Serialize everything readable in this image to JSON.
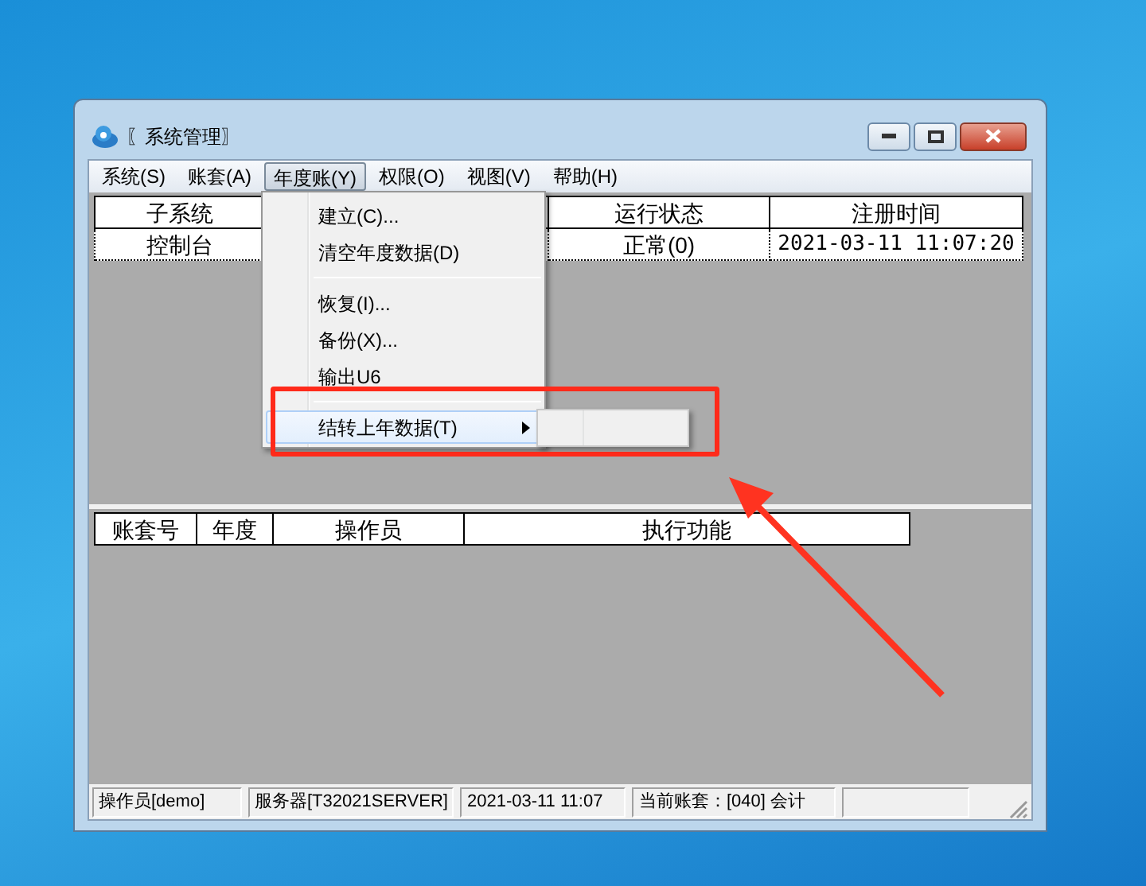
{
  "window": {
    "title": "〖系统管理〗"
  },
  "menu_bar": [
    {
      "label": "系统(S)",
      "selected": false
    },
    {
      "label": "账套(A)",
      "selected": false
    },
    {
      "label": "年度账(Y)",
      "selected": true
    },
    {
      "label": "权限(O)",
      "selected": false
    },
    {
      "label": "视图(V)",
      "selected": false
    },
    {
      "label": "帮助(H)",
      "selected": false
    }
  ],
  "dropdown": [
    {
      "kind": "item",
      "label": "建立(C)...",
      "selected": false,
      "submenu": false
    },
    {
      "kind": "item",
      "label": "清空年度数据(D)",
      "selected": false,
      "submenu": false
    },
    {
      "kind": "separator"
    },
    {
      "kind": "item",
      "label": "恢复(I)...",
      "selected": false,
      "submenu": false
    },
    {
      "kind": "item",
      "label": "备份(X)...",
      "selected": false,
      "submenu": false
    },
    {
      "kind": "item",
      "label": "输出U6",
      "selected": false,
      "submenu": false
    },
    {
      "kind": "separator"
    },
    {
      "kind": "item",
      "label": "结转上年数据(T)",
      "selected": true,
      "submenu": true
    }
  ],
  "upper_table": {
    "columns": [
      "子系统",
      "运行状态",
      "注册时间"
    ],
    "rows": [
      [
        "控制台",
        "正常(0)",
        "2021-03-11 11:07:20"
      ]
    ]
  },
  "lower_table": {
    "columns": [
      "账套号",
      "年度",
      "操作员",
      "执行功能"
    ]
  },
  "status_bar": [
    "操作员[demo]",
    "服务器[T32021SERVER]",
    "2021-03-11 11:07",
    "当前账套：[040] 会计"
  ]
}
